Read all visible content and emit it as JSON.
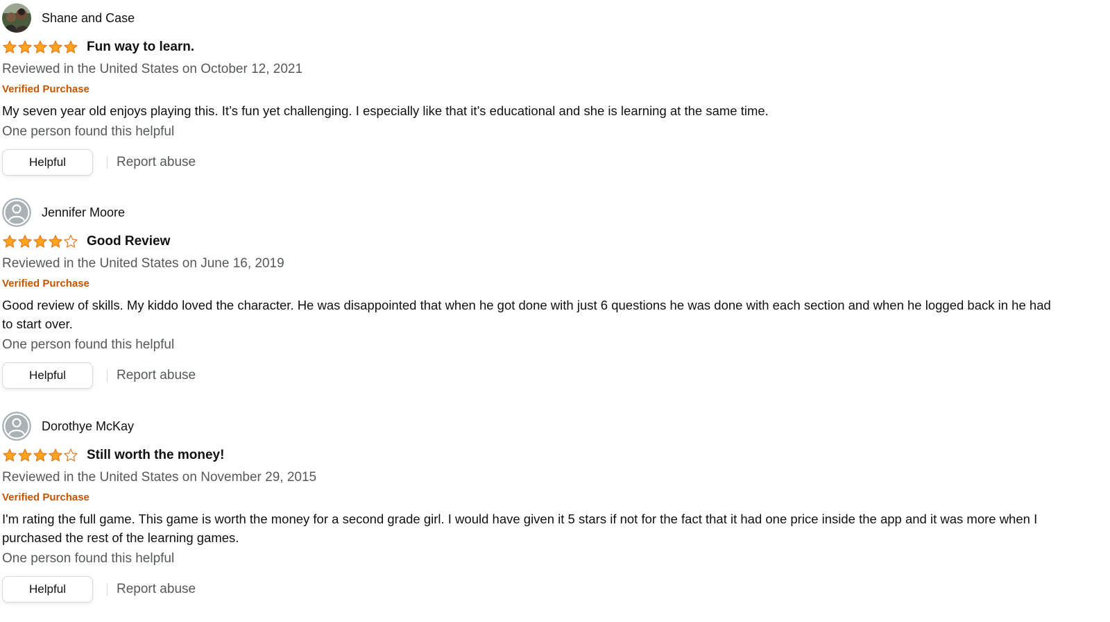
{
  "reviews": [
    {
      "profile_name": "Shane and Case",
      "avatar": "photo-avatar",
      "rating": 5,
      "title": "Fun way to learn.",
      "date": "Reviewed in the United States on October 12, 2021",
      "verified": "Verified Purchase",
      "body": "My seven year old enjoys playing this. It’s fun yet challenging. I especially like that it’s educational and she is learning at the same time.",
      "helpful_count": "One person found this helpful",
      "helpful_label": "Helpful",
      "report_label": "Report abuse"
    },
    {
      "profile_name": "Jennifer Moore",
      "avatar": "default-user-icon",
      "rating": 4,
      "title": "Good Review",
      "date": "Reviewed in the United States on June 16, 2019",
      "verified": "Verified Purchase",
      "body": "Good review of skills. My kiddo loved the character. He was disappointed that when he got done with just 6 questions he was done with each section and when he logged back in he had to start over.",
      "helpful_count": "One person found this helpful",
      "helpful_label": "Helpful",
      "report_label": "Report abuse"
    },
    {
      "profile_name": "Dorothye McKay",
      "avatar": "default-user-icon",
      "rating": 4,
      "title": "Still worth the money!",
      "date": "Reviewed in the United States on November 29, 2015",
      "verified": "Verified Purchase",
      "body": "I'm rating the full game. This game is worth the money for a second grade girl. I would have given it 5 stars if not for the fact that it had one price inside the app and it was more when I purchased the rest of the learning games.",
      "helpful_count": "One person found this helpful",
      "helpful_label": "Helpful",
      "report_label": "Report abuse"
    }
  ],
  "colors": {
    "star": "#ffa41c",
    "star_outline": "#de7921",
    "verified": "#c45500",
    "secondary_text": "#565959",
    "primary_text": "#0f1111"
  }
}
